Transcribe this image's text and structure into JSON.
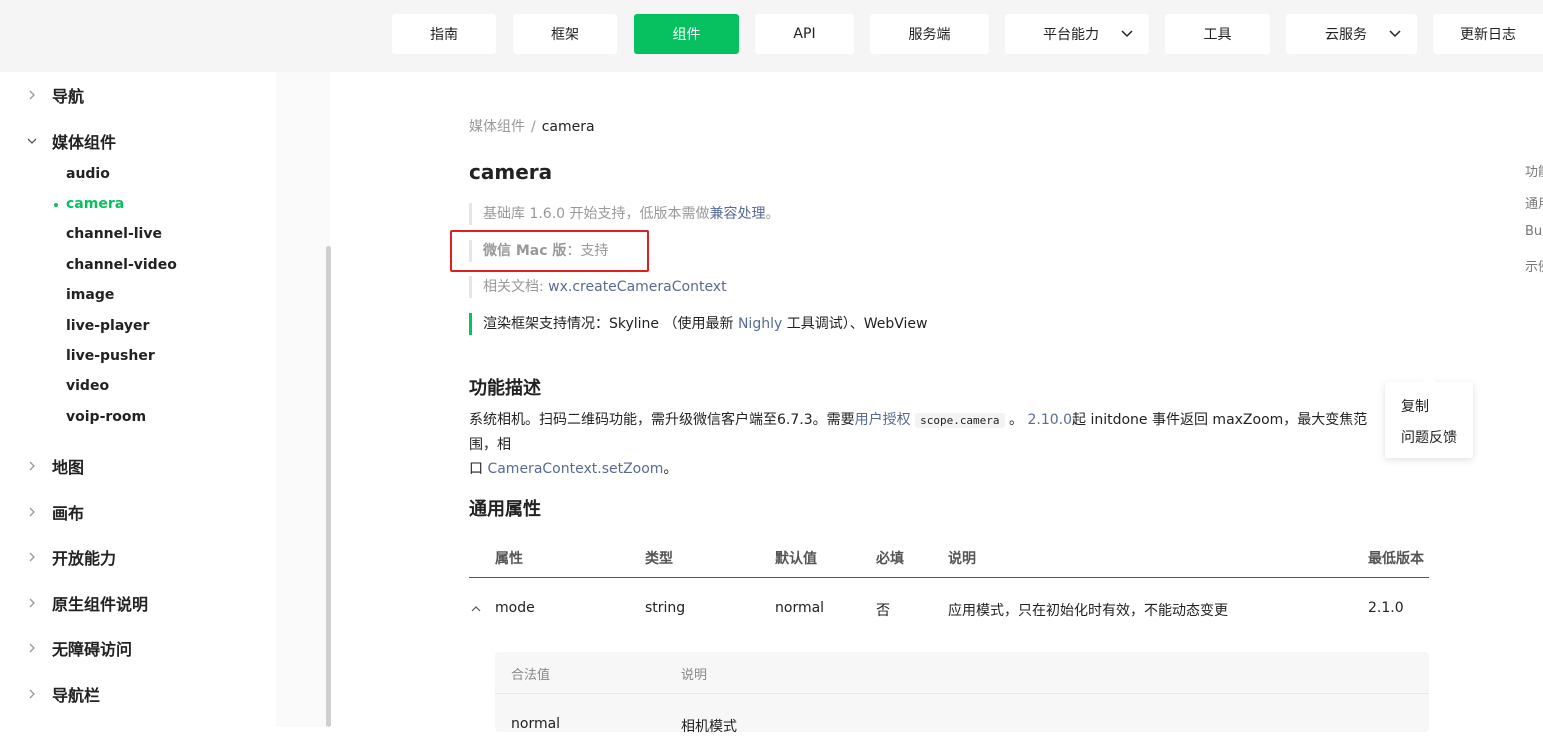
{
  "nav": {
    "items": [
      {
        "label": "指南",
        "active": false
      },
      {
        "label": "框架",
        "active": false
      },
      {
        "label": "组件",
        "active": true
      },
      {
        "label": "API",
        "active": false
      },
      {
        "label": "服务端",
        "active": false
      },
      {
        "label": "平台能力",
        "active": false,
        "dropdown": true
      },
      {
        "label": "工具",
        "active": false
      },
      {
        "label": "云服务",
        "active": false,
        "dropdown": true
      },
      {
        "label": "更新日志",
        "active": false
      }
    ],
    "accent": "#07c160"
  },
  "sidebar": {
    "categories": [
      {
        "label": "导航",
        "expanded": false
      },
      {
        "label": "媒体组件",
        "expanded": true
      },
      {
        "label": "地图",
        "expanded": false
      },
      {
        "label": "画布",
        "expanded": false
      },
      {
        "label": "开放能力",
        "expanded": false
      },
      {
        "label": "原生组件说明",
        "expanded": false
      },
      {
        "label": "无障碍访问",
        "expanded": false
      },
      {
        "label": "导航栏",
        "expanded": false
      }
    ],
    "media_items": [
      "audio",
      "camera",
      "channel-live",
      "channel-video",
      "image",
      "live-player",
      "live-pusher",
      "video",
      "voip-room"
    ],
    "active_item": "camera"
  },
  "breadcrumb": {
    "parent": "媒体组件",
    "separator": "/",
    "current": "camera"
  },
  "page": {
    "title": "camera",
    "support": {
      "prefix": "基础库 1.6.0 开始支持，低版本需做",
      "link": "兼容处理",
      "suffix": "。"
    },
    "mac": {
      "label": "微信 Mac 版",
      "sep": "：",
      "value": "支持"
    },
    "related": {
      "label": "相关文档: ",
      "link": "wx.createCameraContext"
    },
    "render": {
      "prefix": "渲染框架支持情况：Skyline （使用最新 ",
      "link": "Nighly",
      "suffix": " 工具调试）、WebView"
    },
    "section_desc": "功能描述",
    "desc": {
      "p1": "系统相机。扫码二维码功能，需升级微信客户端至6.7.3。需要",
      "link1": "用户授权",
      "code": "scope.camera",
      "p2": "。",
      "link2": "2.10.0",
      "p3": "起 initdone 事件返回 maxZoom，最大变焦范围，相",
      "p4": "口 ",
      "link3": "CameraContext.setZoom",
      "p5": "。"
    },
    "section_attrs": "通用属性"
  },
  "table": {
    "headers": [
      "属性",
      "类型",
      "默认值",
      "必填",
      "说明",
      "最低版本"
    ],
    "rows": [
      {
        "name": "mode",
        "type": "string",
        "default": "normal",
        "required": "否",
        "desc": "应用模式，只在初始化时有效，不能动态变更",
        "version": "2.1.0"
      }
    ],
    "sub_headers": [
      "合法值",
      "说明"
    ],
    "sub_rows": [
      {
        "value": "normal",
        "desc": "相机模式"
      }
    ]
  },
  "toc": [
    "功能",
    "通用",
    "Bu",
    "示例"
  ],
  "popup": {
    "items": [
      "复制",
      "问题反馈"
    ]
  }
}
